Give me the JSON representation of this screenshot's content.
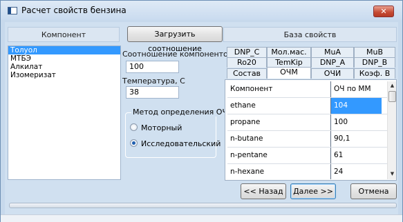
{
  "window": {
    "title": "Расчет свойств бензина",
    "close_label": "✕"
  },
  "left_panel": {
    "header": "Компонент",
    "components": [
      "Толуол",
      "МТБЭ",
      "Алкилат",
      "Изомеризат"
    ],
    "selected_index": 0
  },
  "middle": {
    "load_button": "Загрузить соотношение",
    "ratio_label": "Соотношение компонентов, %",
    "ratio_value": "100",
    "temp_label": "Температура, С",
    "temp_value": "38",
    "method_title": "Метод определения ОЧ",
    "method_options": [
      "Моторный",
      "Исследовательский"
    ],
    "method_selected": "Исследовательский"
  },
  "right_panel": {
    "header": "База свойств",
    "tabs_row1": [
      "DNP_C",
      "Мол.мас.",
      "MuA",
      "MuB"
    ],
    "tabs_row2": [
      "Ro20",
      "TemKip",
      "DNP_A",
      "DNP_B"
    ],
    "tabs_row3": [
      "Состав",
      "ОЧМ",
      "ОЧИ",
      "Коэф. В"
    ],
    "active_tab": "ОЧМ",
    "grid": {
      "columns": [
        "Компонент",
        "ОЧ по ММ"
      ],
      "rows": [
        [
          "ethane",
          "104"
        ],
        [
          "propane",
          "100"
        ],
        [
          "n-butane",
          "90,1"
        ],
        [
          "n-pentane",
          "61"
        ],
        [
          "n-hexane",
          "24"
        ]
      ],
      "highlighted_cell": {
        "row": 0,
        "col": 1
      }
    }
  },
  "footer": {
    "back_button": "<< Назад",
    "next_button": "Далее >>",
    "cancel_button": "Отмена"
  },
  "colors": {
    "accent": "#3399ff",
    "background": "#d0e0f0",
    "titlebar": "#c9dbef",
    "close": "#c54a33"
  }
}
